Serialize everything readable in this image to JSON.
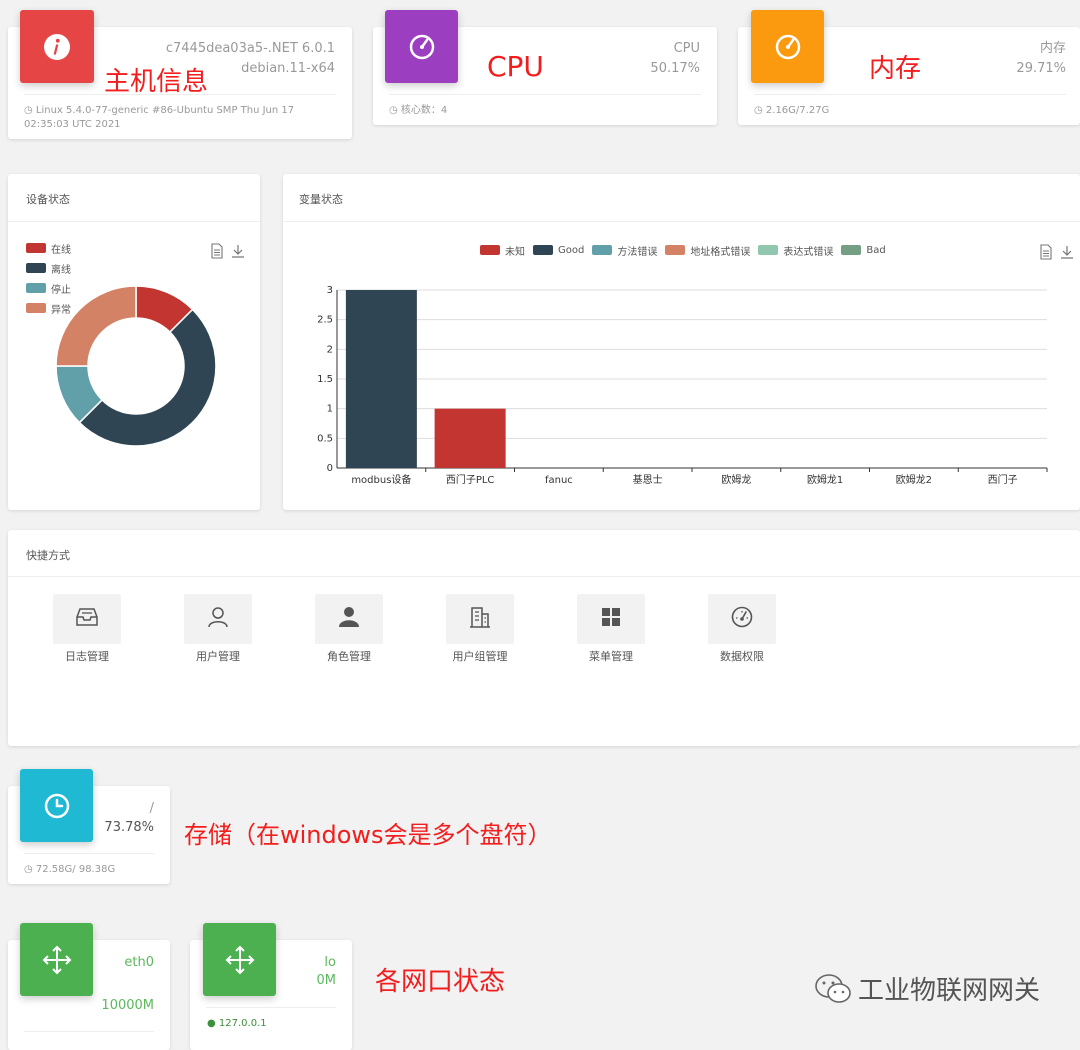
{
  "host": {
    "hostname_line": "c7445dea03a5-.NET 6.0.1",
    "os_line": "debian.11-x64",
    "kernel": "Linux 5.4.0-77-generic #86-Ubuntu SMP Thu Jun 17 02:35:03 UTC 2021",
    "annotation": "主机信息",
    "icon_color": "#e64545"
  },
  "cpu": {
    "label": "CPU",
    "value": "50.17%",
    "cores": "核心数：4",
    "annotation": "CPU",
    "icon_color": "#9c3ec0"
  },
  "memory": {
    "label": "内存",
    "value": "29.71%",
    "usage": "2.16G/7.27G",
    "annotation": "内存",
    "icon_color": "#fb9a0f"
  },
  "device_panel": {
    "title": "设备状态",
    "colors": [
      "#c23531",
      "#2f4554",
      "#61a0a8",
      "#d48265"
    ]
  },
  "variable_panel": {
    "title": "变量状态"
  },
  "chart_data": [
    {
      "type": "pie",
      "legend": [
        "在线",
        "离线",
        "停止",
        "异常"
      ],
      "values": [
        1,
        4,
        1,
        2
      ],
      "legend_position": "top-left"
    },
    {
      "type": "bar",
      "legend": [
        "未知",
        "Good",
        "方法错误",
        "地址格式错误",
        "表达式错误",
        "Bad"
      ],
      "legend_colors": [
        "#c23531",
        "#2f4554",
        "#61a0a8",
        "#d48265",
        "#91c7ae",
        "#749f83"
      ],
      "categories": [
        "modbus设备",
        "西门子PLC",
        "fanuc",
        "基恩士",
        "欧姆龙",
        "欧姆龙1",
        "欧姆龙2",
        "西门子"
      ],
      "series": [
        {
          "name": "未知",
          "values": [
            0,
            1,
            0,
            0,
            0,
            0,
            0,
            0
          ]
        },
        {
          "name": "Good",
          "values": [
            3,
            0,
            0,
            0,
            0,
            0,
            0,
            0
          ]
        },
        {
          "name": "方法错误",
          "values": [
            0,
            0,
            0,
            0,
            0,
            0,
            0,
            0
          ]
        },
        {
          "name": "地址格式错误",
          "values": [
            0,
            0,
            0,
            0,
            0,
            0,
            0,
            0
          ]
        },
        {
          "name": "表达式错误",
          "values": [
            0,
            0,
            0,
            0,
            0,
            0,
            0,
            0
          ]
        },
        {
          "name": "Bad",
          "values": [
            0,
            0,
            0,
            0,
            0,
            0,
            0,
            0
          ]
        }
      ],
      "yticks": [
        "0",
        "0.5",
        "1",
        "1.5",
        "2",
        "2.5",
        "3"
      ],
      "ylim": [
        0,
        3
      ],
      "grid": true,
      "legend_position": "top"
    }
  ],
  "shortcuts": {
    "title": "快捷方式",
    "items": [
      {
        "label": "日志管理",
        "icon": "inbox-icon"
      },
      {
        "label": "用户管理",
        "icon": "user-outline-icon"
      },
      {
        "label": "角色管理",
        "icon": "user-solid-icon"
      },
      {
        "label": "用户组管理",
        "icon": "building-icon"
      },
      {
        "label": "菜单管理",
        "icon": "grid-icon"
      },
      {
        "label": "数据权限",
        "icon": "gauge-icon"
      }
    ]
  },
  "storage": {
    "mount": "/",
    "value": "73.78%",
    "usage": "72.58G/ 98.38G",
    "annotation": "存储（在windows会是多个盘符）",
    "icon_color": "#1fb9d4"
  },
  "network": {
    "annotation": "各网口状态",
    "icon_color": "#4caf50",
    "interfaces": [
      {
        "name": "eth0",
        "speed": "10000M",
        "ip": ""
      },
      {
        "name": "lo",
        "speed": "0M",
        "ip": "127.0.0.1"
      }
    ]
  },
  "watermark": "工业物联网网关"
}
